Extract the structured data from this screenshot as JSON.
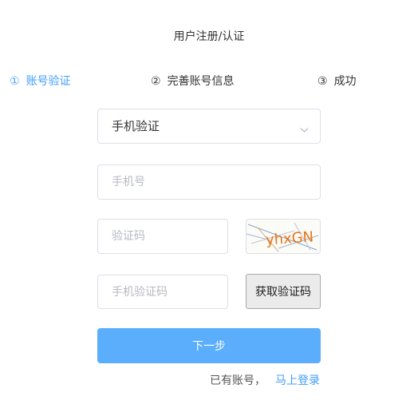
{
  "page": {
    "title": "用户注册/认证"
  },
  "steps": [
    {
      "number": "①",
      "label": "账号验证",
      "active": true
    },
    {
      "number": "②",
      "label": "完善账号信息",
      "active": false
    },
    {
      "number": "③",
      "label": "成功",
      "active": false
    }
  ],
  "form": {
    "method_select": {
      "value": "手机验证",
      "icon": "chevron-down-icon"
    },
    "phone": {
      "value": "",
      "placeholder": "手机号"
    },
    "captcha_code": {
      "value": "",
      "placeholder": "验证码"
    },
    "captcha_image": {
      "text": "yhxGN"
    },
    "sms_code": {
      "value": "",
      "placeholder": "手机验证码"
    },
    "get_sms_button": "获取验证码",
    "next_button": "下一步"
  },
  "login": {
    "prompt": "已有账号，",
    "link": "马上登录"
  },
  "colors": {
    "accent": "#409eff",
    "primary_button": "#5aaefc",
    "border": "#dcdfe6",
    "captcha_text": "#e8751a"
  }
}
